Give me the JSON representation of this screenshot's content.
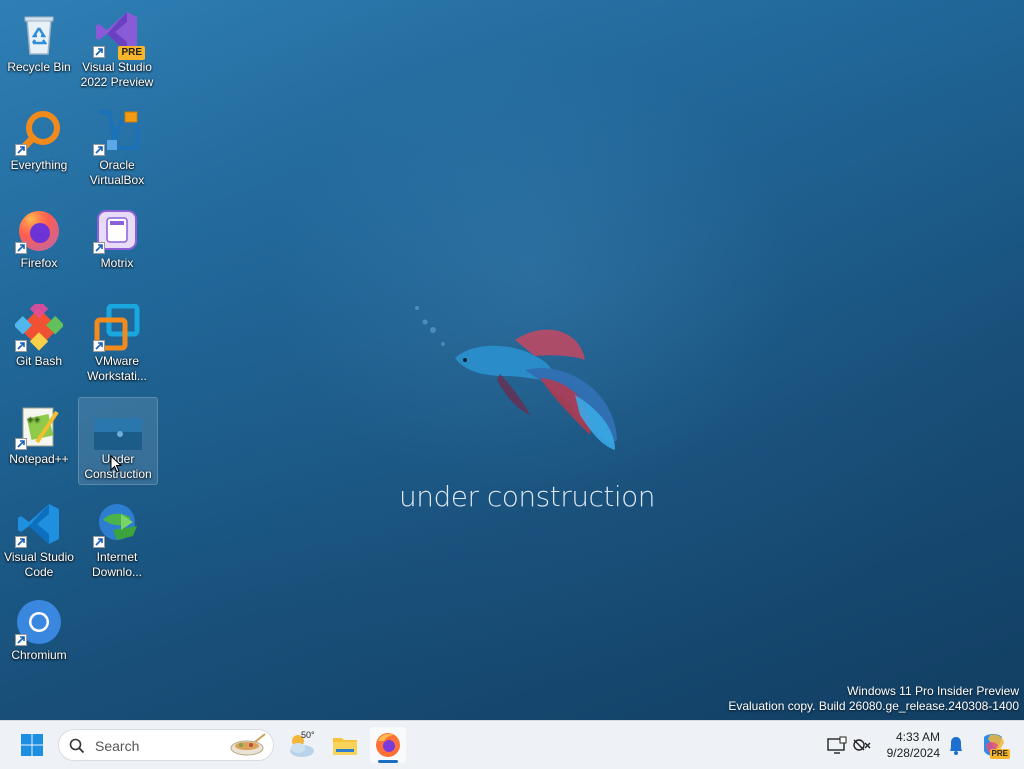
{
  "desktop_icons": [
    {
      "label": "Recycle Bin",
      "icon": "recycle-bin-icon"
    },
    {
      "label": "Visual Studio 2022 Preview",
      "icon": "visual-studio-icon",
      "badge": "PRE"
    },
    {
      "label": "Everything",
      "icon": "everything-search-icon"
    },
    {
      "label": "Oracle VirtualBox",
      "icon": "virtualbox-icon"
    },
    {
      "label": "Firefox",
      "icon": "firefox-icon"
    },
    {
      "label": "Motrix",
      "icon": "motrix-icon"
    },
    {
      "label": "Git Bash",
      "icon": "git-bash-icon"
    },
    {
      "label": "VMware Workstati...",
      "icon": "vmware-icon"
    },
    {
      "label": "Notepad++",
      "icon": "notepadpp-icon"
    },
    {
      "label": "Under Construction",
      "icon": "image-file-icon"
    },
    {
      "label": "Visual Studio Code",
      "icon": "vscode-icon"
    },
    {
      "label": "Internet Downlo...",
      "icon": "idm-icon"
    },
    {
      "label": "Chromium",
      "icon": "chromium-icon"
    }
  ],
  "wallpaper": {
    "text": "under construction"
  },
  "watermark": {
    "line1": "Windows 11 Pro Insider Preview",
    "line2": "Evaluation copy. Build 26080.ge_release.240308-1400"
  },
  "taskbar": {
    "search_placeholder": "Search",
    "weather_temp": "50°",
    "clock_time": "4:33 AM",
    "clock_date": "9/28/2024",
    "copilot_badge": "PRE"
  },
  "colors": {
    "accent": "#0078d4",
    "taskbar_bg": "#eef2f6",
    "desktop_top": "#2f7fb5",
    "desktop_bottom": "#123e62"
  }
}
